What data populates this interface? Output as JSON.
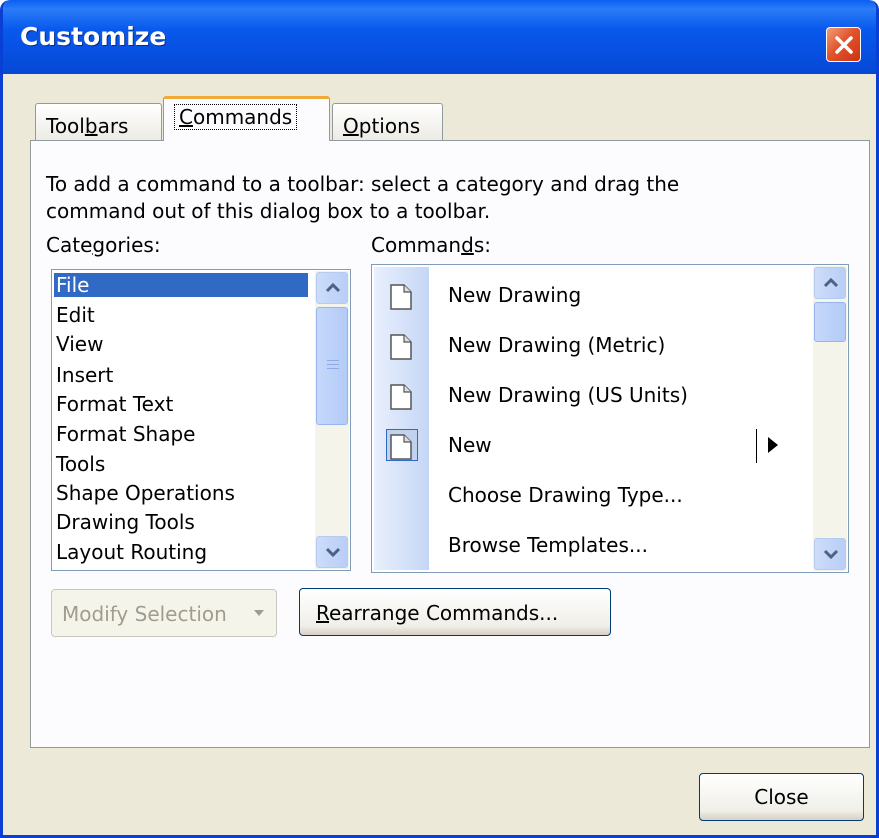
{
  "window": {
    "title": "Customize"
  },
  "tabs": [
    {
      "pre": "Tool",
      "key": "b",
      "post": "ars"
    },
    {
      "pre": "",
      "key": "C",
      "post": "ommands"
    },
    {
      "pre": "",
      "key": "O",
      "post": "ptions"
    }
  ],
  "instructions": {
    "line1": "To add a command to a toolbar: select a category and drag the",
    "line2": "command out of this dialog box to a toolbar."
  },
  "categories": {
    "label_pre": "Cate",
    "label_key": "g",
    "label_post": "ories:",
    "items": [
      "File",
      "Edit",
      "View",
      "Insert",
      "Format Text",
      "Format Shape",
      "Tools",
      "Shape Operations",
      "Drawing Tools",
      "Layout  Routing"
    ],
    "selected": "File"
  },
  "commands": {
    "label_pre": "Comman",
    "label_key": "d",
    "label_post": "s:",
    "items": [
      {
        "label": "New Drawing",
        "icon": "document-icon"
      },
      {
        "label": "New Drawing (Metric)",
        "icon": "document-icon"
      },
      {
        "label": "New Drawing (US Units)",
        "icon": "document-icon"
      },
      {
        "label": "New",
        "icon": "document-icon",
        "submenu": true
      },
      {
        "label": "Choose Drawing Type...",
        "icon": ""
      },
      {
        "label": "Browse Templates...",
        "icon": ""
      }
    ]
  },
  "buttons": {
    "modify_selection": "Modify Selection",
    "rearrange_key": "R",
    "rearrange_rest": "earrange Commands...",
    "close": "Close"
  }
}
